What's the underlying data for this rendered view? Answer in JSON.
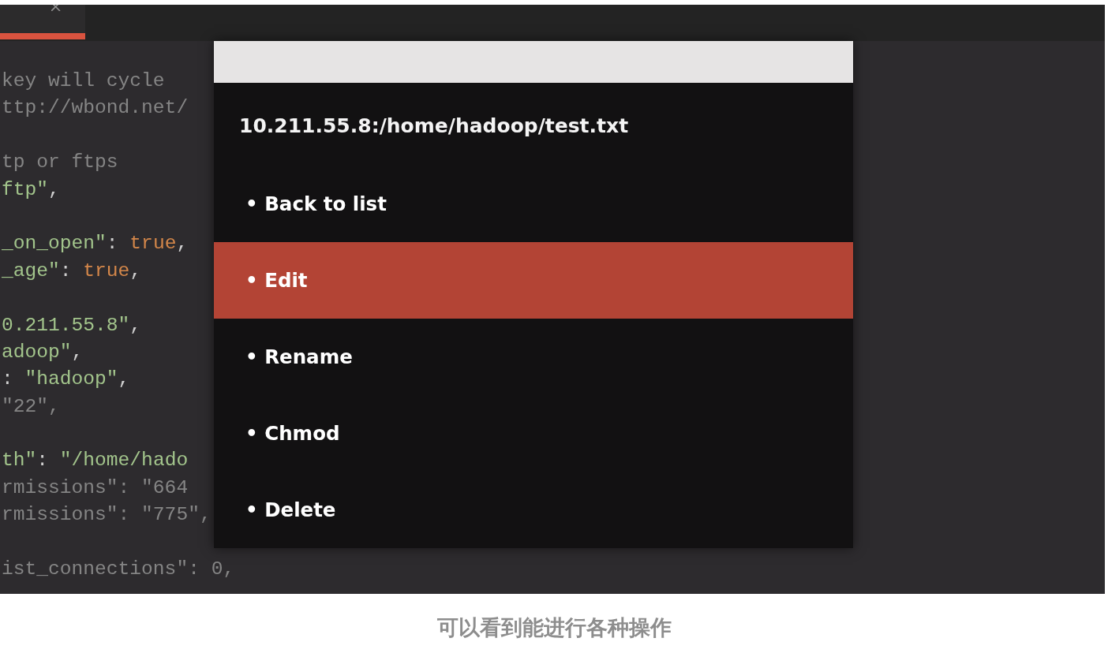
{
  "editor": {
    "tabs": [
      {
        "selected": true
      }
    ],
    "code_blocks": [
      {
        "lines": [
          {
            "tokens": [
              {
                "kind": "comment",
                "text": "key will cycle"
              }
            ]
          },
          {
            "tokens": [
              {
                "kind": "comment",
                "text": "ttp://wbond.net/"
              }
            ]
          }
        ]
      },
      {
        "lines": [
          {
            "tokens": [
              {
                "kind": "comment",
                "text": "tp or ftps"
              }
            ]
          },
          {
            "tokens": [
              {
                "kind": "string",
                "text": "ftp\""
              },
              {
                "kind": "punct",
                "text": ","
              }
            ]
          }
        ]
      },
      {
        "lines": [
          {
            "tokens": [
              {
                "kind": "string",
                "text": "_on_open\""
              },
              {
                "kind": "punct",
                "text": ": "
              },
              {
                "kind": "keyword",
                "text": "true"
              },
              {
                "kind": "punct",
                "text": ","
              }
            ]
          },
          {
            "tokens": [
              {
                "kind": "string",
                "text": "_age\""
              },
              {
                "kind": "punct",
                "text": ": "
              },
              {
                "kind": "keyword",
                "text": "true"
              },
              {
                "kind": "punct",
                "text": ","
              }
            ]
          }
        ]
      },
      {
        "lines": [
          {
            "tokens": [
              {
                "kind": "string",
                "text": "0.211.55.8\""
              },
              {
                "kind": "punct",
                "text": ","
              }
            ]
          },
          {
            "tokens": [
              {
                "kind": "string",
                "text": "adoop\""
              },
              {
                "kind": "punct",
                "text": ","
              }
            ]
          },
          {
            "tokens": [
              {
                "kind": "punct",
                "text": ": "
              },
              {
                "kind": "string",
                "text": "\"hadoop\""
              },
              {
                "kind": "punct",
                "text": ","
              }
            ]
          },
          {
            "tokens": [
              {
                "kind": "comment",
                "text": "\"22\","
              }
            ]
          }
        ]
      },
      {
        "lines": [
          {
            "tokens": [
              {
                "kind": "string",
                "text": "th\""
              },
              {
                "kind": "punct",
                "text": ": "
              },
              {
                "kind": "string",
                "text": "\"/home/hado"
              }
            ]
          },
          {
            "tokens": [
              {
                "kind": "comment",
                "text": "rmissions\": \"664"
              }
            ]
          },
          {
            "tokens": [
              {
                "kind": "comment",
                "text": "rmissions\": \"775\","
              }
            ]
          }
        ]
      },
      {
        "lines": [
          {
            "tokens": [
              {
                "kind": "comment",
                "text": "ist_connections\": 0,"
              }
            ]
          }
        ]
      }
    ]
  },
  "quick_panel": {
    "title": "10.211.55.8:/home/hadoop/test.txt",
    "items": [
      {
        "label": "• Back to list",
        "selected": false
      },
      {
        "label": "• Edit",
        "selected": true
      },
      {
        "label": "• Rename",
        "selected": false
      },
      {
        "label": "• Chmod",
        "selected": false
      },
      {
        "label": "• Delete",
        "selected": false
      }
    ]
  },
  "caption": "可以看到能进行各种操作"
}
